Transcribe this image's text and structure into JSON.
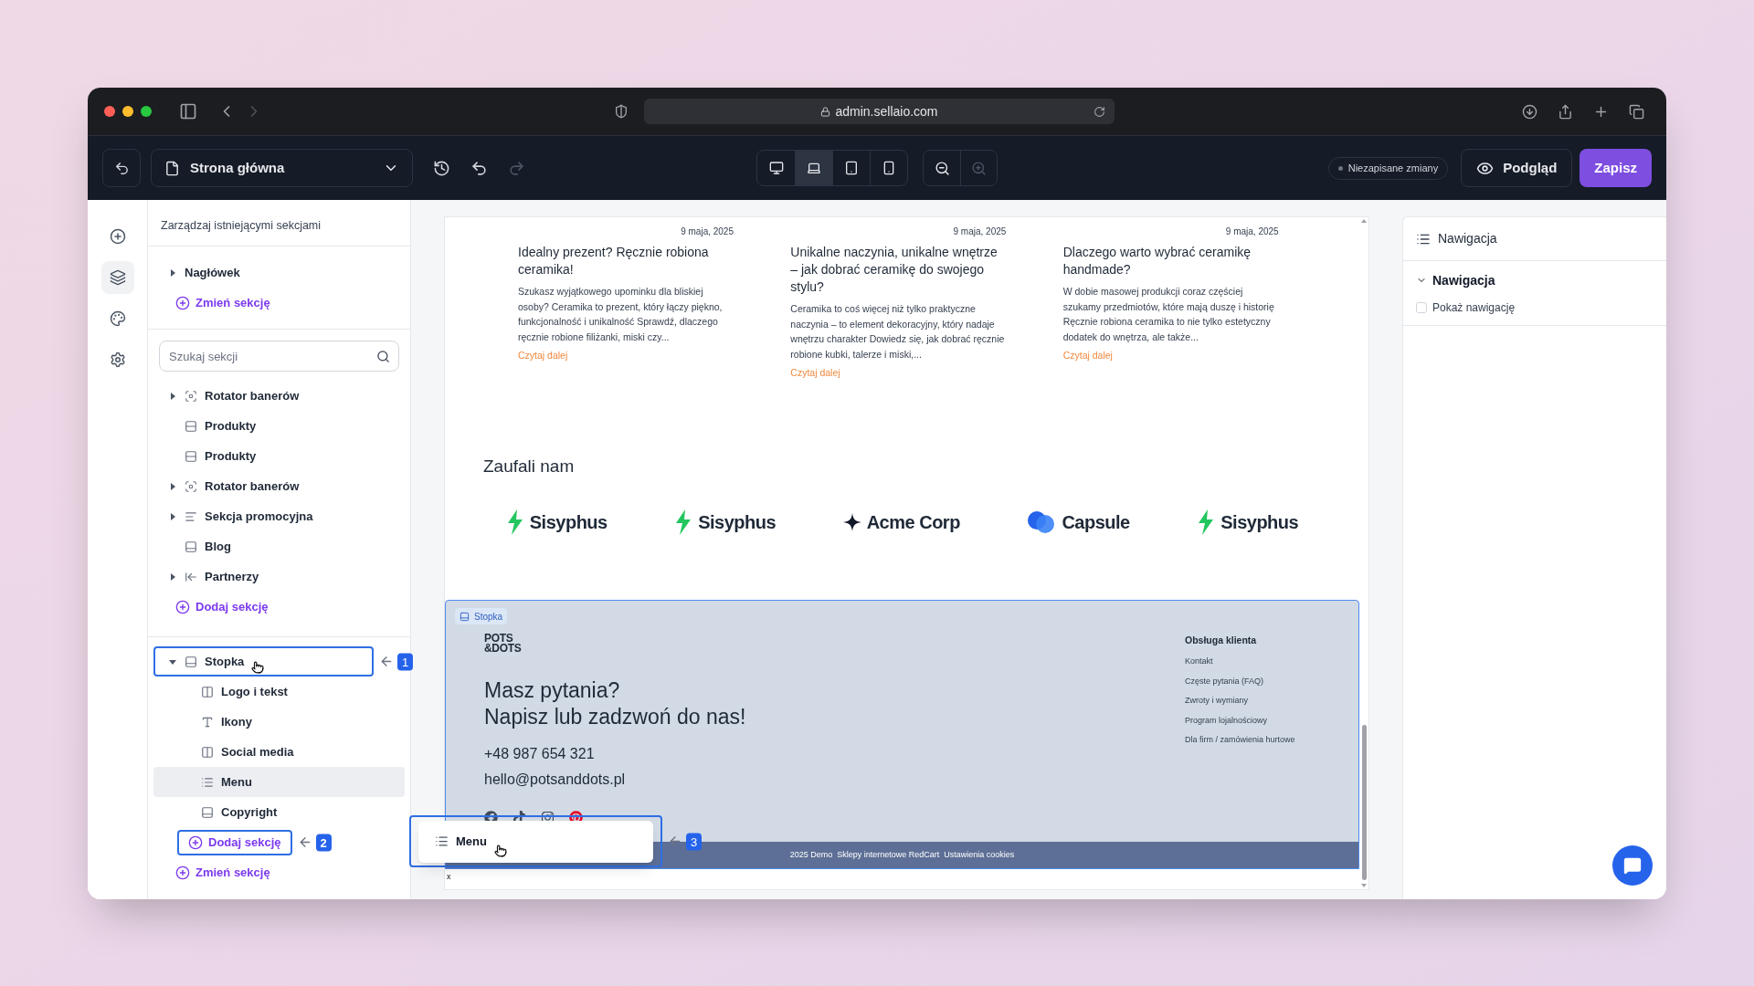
{
  "browser": {
    "url": "admin.sellaio.com"
  },
  "toolbar": {
    "page": "Strona główna",
    "redo": {
      "disabled": true
    },
    "devices": [
      {
        "kind": "desktop",
        "selected": false
      },
      {
        "kind": "laptop",
        "selected": true
      },
      {
        "kind": "tablet",
        "selected": false
      },
      {
        "kind": "phone",
        "selected": false
      }
    ],
    "zoom_in": {
      "disabled": true
    },
    "status": "Niezapisane zmiany",
    "preview": "Podgląd",
    "save": "Zapisz"
  },
  "rail": [
    {
      "kind": "add",
      "selected": false
    },
    {
      "kind": "layers",
      "selected": true
    },
    {
      "kind": "theme",
      "selected": false
    },
    {
      "kind": "settings",
      "selected": false
    }
  ],
  "sidebar": {
    "subtitle": "Zarządzaj istniejącymi sekcjami",
    "header": {
      "items": [
        {
          "label": "Nagłówek",
          "expanded": false,
          "selected": false
        }
      ],
      "action": "Zmień sekcję"
    },
    "search": {
      "placeholder": "Szukaj sekcji"
    },
    "template": {
      "items": [
        {
          "label": "Rotator banerów",
          "kind": "banner-rotator",
          "expanded": false,
          "selected": false
        },
        {
          "label": "Produkty",
          "kind": "products",
          "selected": false
        },
        {
          "label": "Produkty",
          "kind": "products",
          "selected": false
        },
        {
          "label": "Rotator banerów",
          "kind": "banner-rotator",
          "expanded": false,
          "selected": false
        },
        {
          "label": "Sekcja promocyjna",
          "kind": "promo",
          "expanded": false,
          "selected": false
        },
        {
          "label": "Blog",
          "kind": "blog",
          "selected": false
        },
        {
          "label": "Partnerzy",
          "kind": "partners",
          "expanded": false,
          "selected": false
        }
      ],
      "action": "Dodaj sekcję"
    },
    "footer": {
      "items": [
        {
          "label": "Stopka",
          "kind": "footer",
          "expanded": true,
          "selected": false,
          "callout": "1",
          "children": [
            {
              "label": "Logo i tekst",
              "kind": "logo-text",
              "selected": false
            },
            {
              "label": "Ikony",
              "kind": "text",
              "selected": false
            },
            {
              "label": "Social media",
              "kind": "social",
              "selected": false
            },
            {
              "label": "Menu",
              "kind": "menu",
              "selected": true
            },
            {
              "label": "Copyright",
              "kind": "copyright",
              "selected": false
            }
          ]
        }
      ],
      "add_action": {
        "label": "Dodaj sekcję",
        "callout": "2"
      },
      "change_action": "Zmień sekcję"
    }
  },
  "canvas": {
    "posts": [
      {
        "date": "9 maja, 2025",
        "title": "Idealny prezent? Ręcznie robiona ceramika!",
        "excerpt": "Szukasz wyjątkowego upominku dla bliskiej osoby? Ceramika to prezent, który łączy piękno, funkcjonalność i unikalność Sprawdź, dlaczego ręcznie robione filiżanki, miski czy...",
        "link": "Czytaj dalej"
      },
      {
        "date": "9 maja, 2025",
        "title": "Unikalne naczynia, unikalne wnętrze – jak dobrać ceramikę do swojego stylu?",
        "excerpt": "Ceramika to coś więcej niż tylko praktyczne naczynia – to element dekoracyjny, który nadaje wnętrzu charakter Dowiedz się, jak dobrać ręcznie robione kubki, talerze i miski,...",
        "link": "Czytaj dalej"
      },
      {
        "date": "9 maja, 2025",
        "title": "Dlaczego warto wybrać ceramikę handmade?",
        "excerpt": "W dobie masowej produkcji coraz częściej szukamy przedmiotów, które mają duszę i historię Ręcznie robiona ceramika to nie tylko estetyczny dodatek do wnętrza, ale także...",
        "link": "Czytaj dalej"
      }
    ],
    "partners": {
      "title": "Zaufali nam",
      "logos": [
        {
          "kind": "bolt",
          "name": "Sisyphus"
        },
        {
          "kind": "bolt",
          "name": "Sisyphus"
        },
        {
          "kind": "star",
          "name": "Acme Corp"
        },
        {
          "kind": "capsule",
          "name": "Capsule"
        },
        {
          "kind": "bolt",
          "name": "Sisyphus"
        }
      ]
    },
    "footer": {
      "badge": "Stopka",
      "logo": [
        "POTS",
        "&DOTS"
      ],
      "heading": [
        "Masz pytania?",
        "Napisz lub zadzwoń do nas!"
      ],
      "phone": "+48 987 654 321",
      "email": "hello@potsanddots.pl",
      "menu": {
        "title": "Obsługa klienta",
        "links": [
          "Kontakt",
          "Częste pytania (FAQ)",
          "Zwroty i wymiany",
          "Program lojalnościowy",
          "Dla firm / zamówienia hurtowe"
        ]
      },
      "bottom": [
        "2025 Demo",
        "Sklepy internetowe RedCart",
        "Ustawienia cookies"
      ]
    },
    "trailing": "x"
  },
  "drag_preview": {
    "label": "Menu",
    "callout": "3"
  },
  "inspector": {
    "title": "Nawigacja",
    "section": {
      "title": "Nawigacja",
      "expanded": true
    },
    "checkbox": {
      "label": "Pokaż nawigację",
      "checked": false
    }
  }
}
